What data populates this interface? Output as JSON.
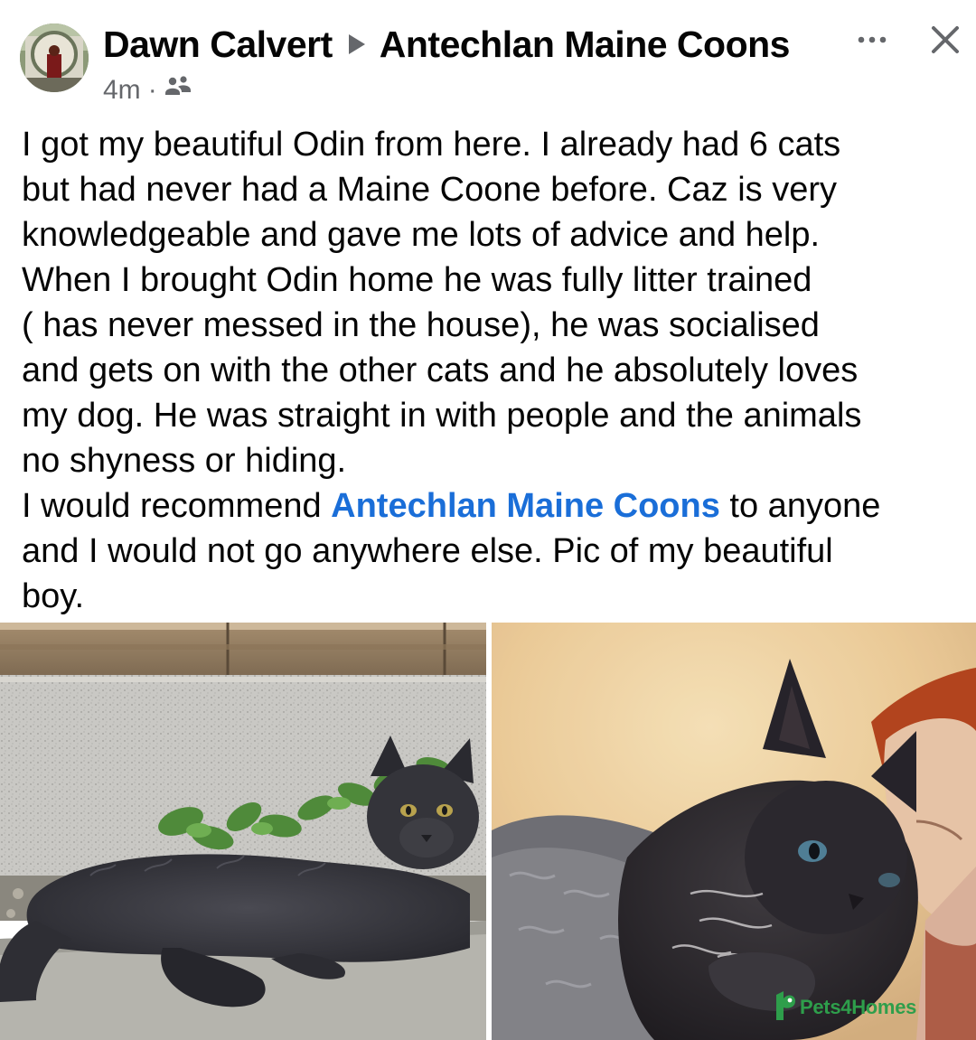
{
  "post": {
    "author": "Dawn Calvert",
    "group": "Antechlan Maine Coons",
    "time": "4m",
    "separator": "·",
    "audience_icon": "group-audience-icon",
    "more_label": "···",
    "close_label": "✕",
    "text_lines": [
      "I got my beautiful Odin from here. I already had 6 cats",
      "but had never had a Maine Coone before. Caz is very",
      "knowledgeable and gave me lots of advice and help.",
      "When I brought Odin home he was fully litter trained",
      "( has never messed in the house), he was socialised",
      "and gets on with the other cats and he absolutely loves",
      "my dog. He was straight in with people and the animals",
      "no shyness or hiding."
    ],
    "recommend_prefix": "I would recommend ",
    "recommend_link": "Antechlan Maine Coons",
    "recommend_suffix": " to anyone",
    "closing_lines": [
      "and I would not go anywhere else. Pic of my beautiful",
      "boy."
    ],
    "link_color": "#1a6ed8",
    "muted_color": "#65676b"
  },
  "watermark": {
    "text": "Pets4Homes",
    "color": "#2e9e4b"
  }
}
